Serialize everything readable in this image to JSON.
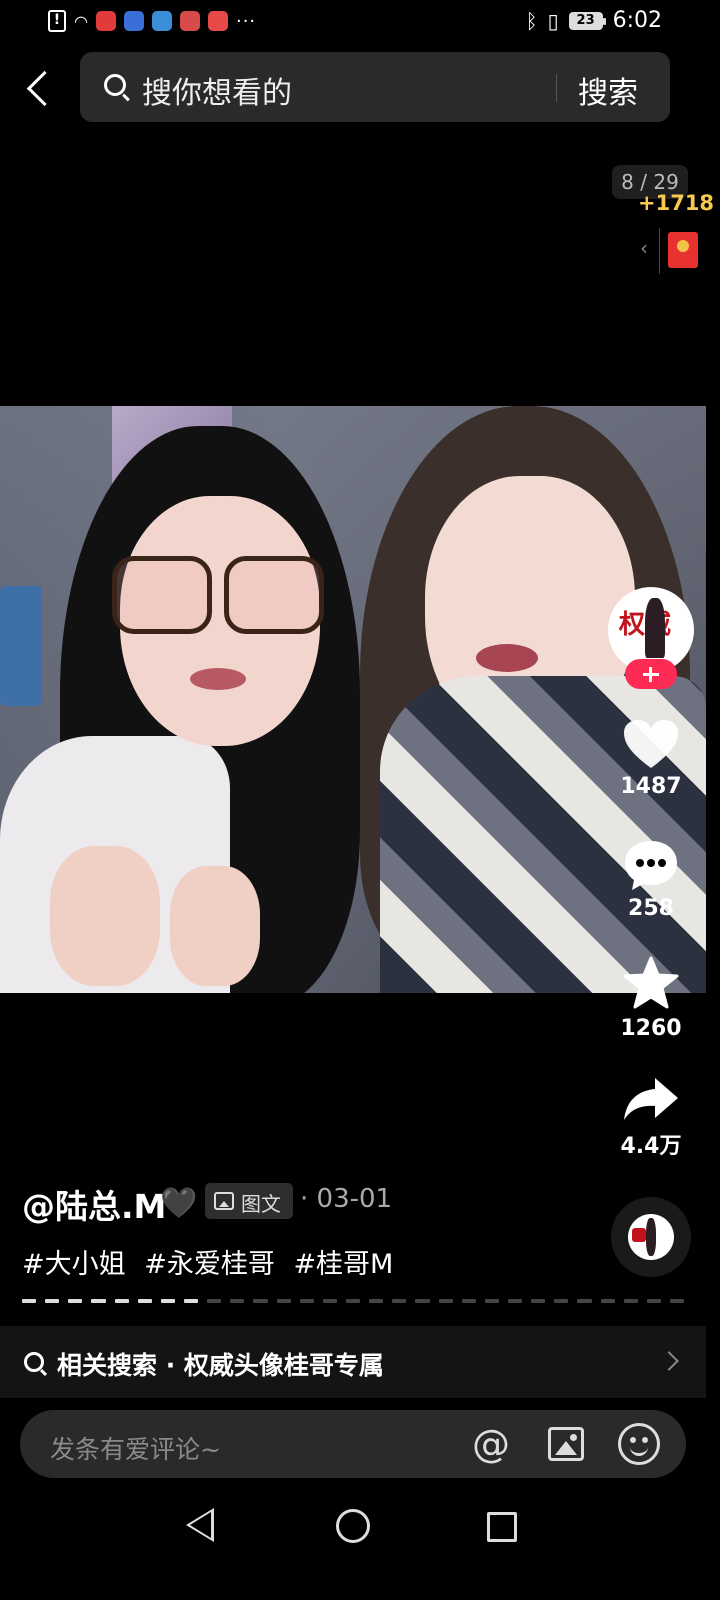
{
  "status_bar": {
    "time": "6:02",
    "battery": "23",
    "overflow_dots": "···",
    "app_icon_colors": [
      "#e23b3b",
      "#3b6fd8",
      "#3b8fd8",
      "#d84b4b",
      "#e84a4a"
    ]
  },
  "search": {
    "placeholder": "搜你想看的",
    "button_label": "搜索"
  },
  "viewer": {
    "page_counter": "8 / 29",
    "reward_count": "+1718"
  },
  "actions": {
    "likes": "1487",
    "comments": "258",
    "favorites": "1260",
    "shares": "4.4万"
  },
  "avatar_art_text": "权威",
  "post": {
    "author": "@陆总.M",
    "author_emoji": "🖤",
    "type_tag": "图文",
    "date": "· 03-01",
    "hashtags": [
      "#大小姐",
      "#永爱桂哥",
      "#桂哥M"
    ],
    "progress": {
      "current": 8,
      "total": 29
    }
  },
  "related_search": "相关搜索 · 权威头像桂哥专属",
  "comment_input": {
    "placeholder": "发条有爱评论~"
  },
  "colors": {
    "accent": "#fe2c55",
    "reward": "#f7c94f"
  }
}
